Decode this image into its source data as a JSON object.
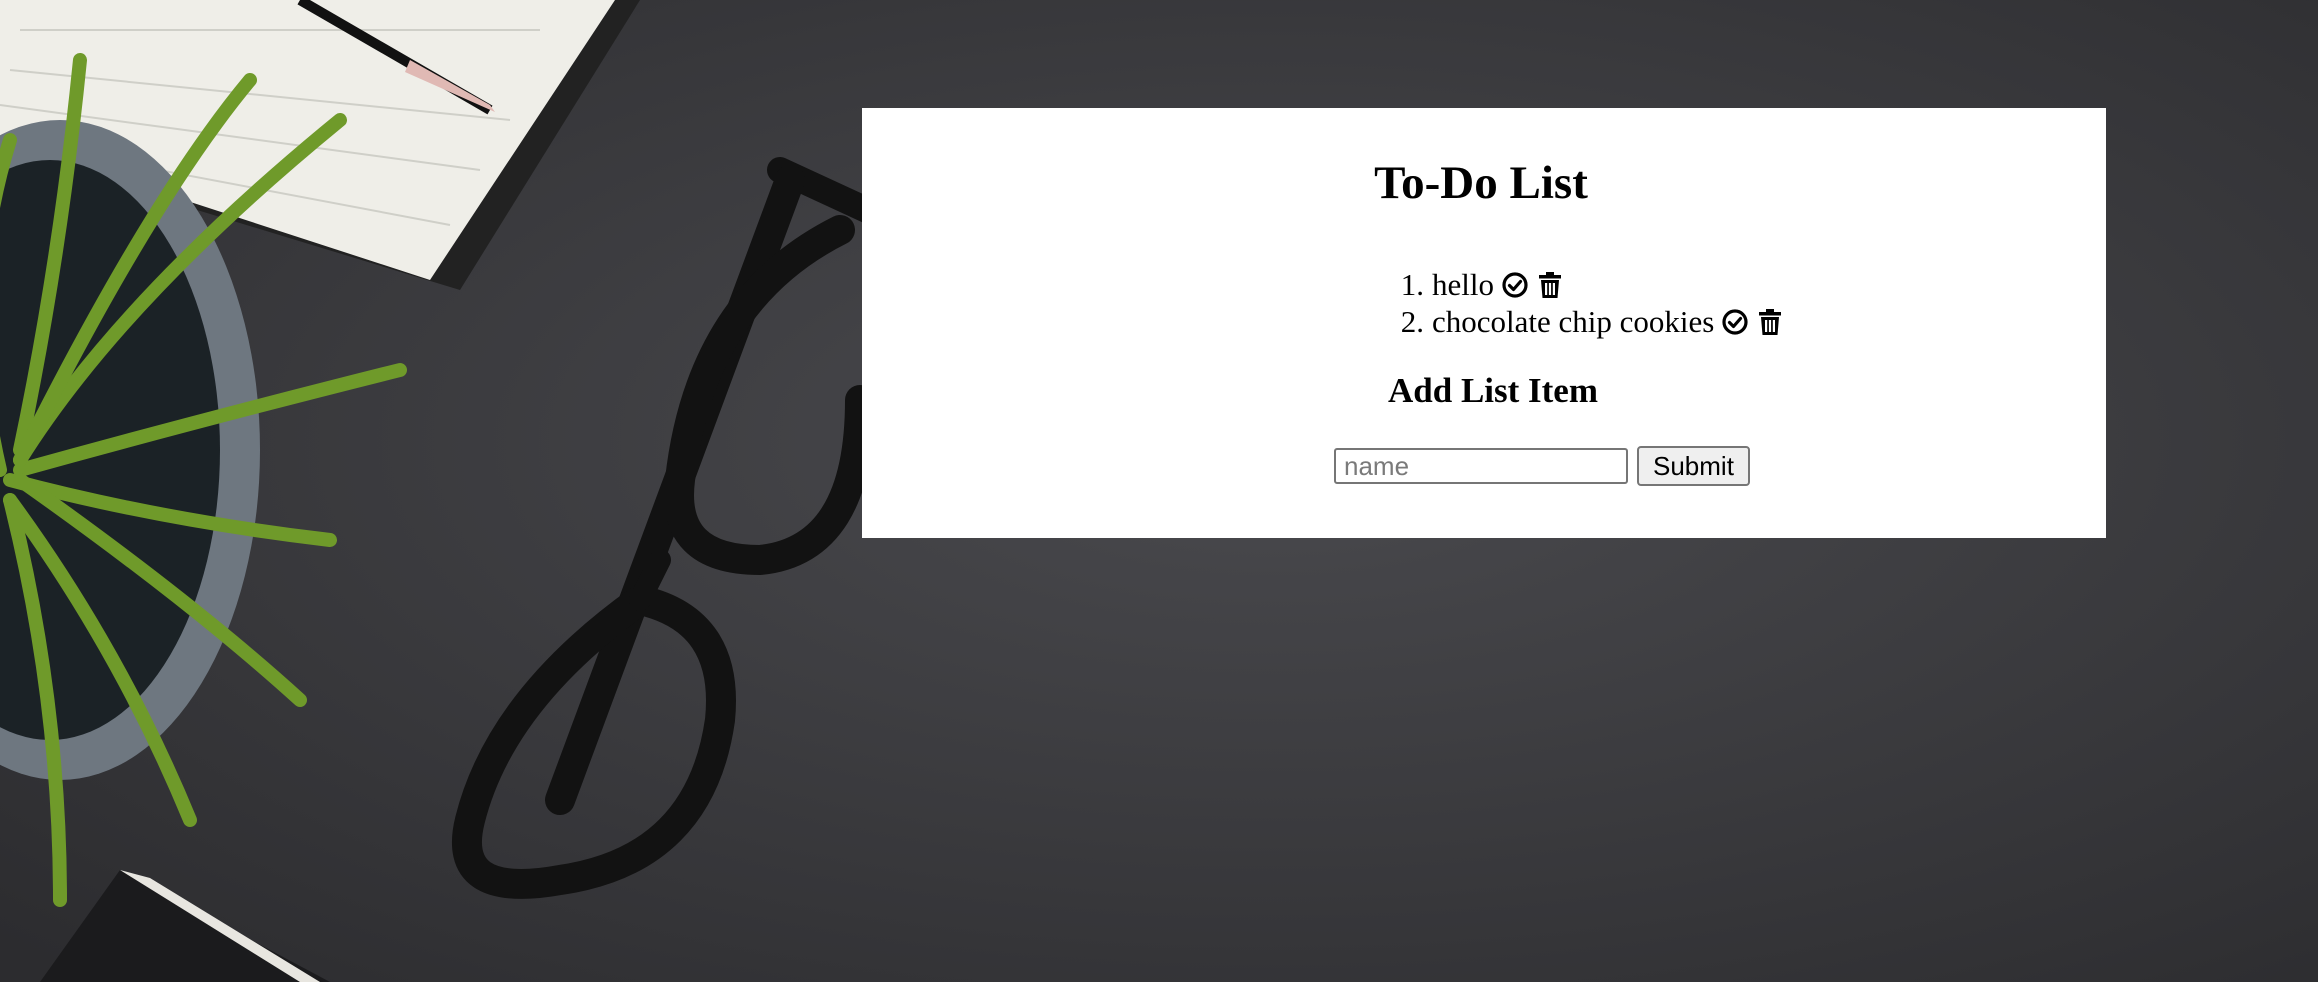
{
  "page": {
    "title": "To-Do List",
    "add_heading": "Add List Item"
  },
  "todos": [
    {
      "number": "1.",
      "text": "hello",
      "complete_icon": "check-circle-icon",
      "delete_icon": "trash-icon"
    },
    {
      "number": "2.",
      "text": "chocolate chip cookies",
      "complete_icon": "check-circle-icon",
      "delete_icon": "trash-icon"
    }
  ],
  "form": {
    "input_placeholder": "name",
    "input_value": "",
    "submit_label": "Submit"
  },
  "colors": {
    "card_background": "#ffffff",
    "desk_background": "#3a3a3d",
    "text": "#000000"
  }
}
